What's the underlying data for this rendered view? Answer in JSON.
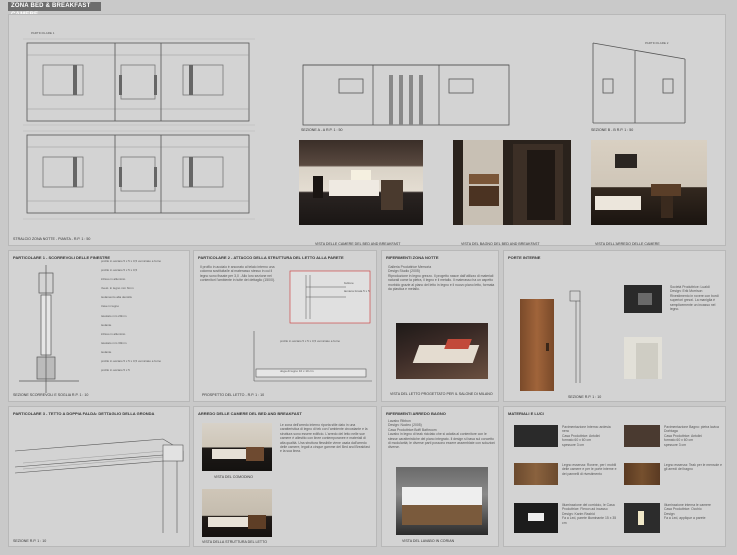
{
  "header": {
    "title": "ZONA BED & BREAKFAST CAMERE"
  },
  "top": {
    "plan_caption": "STRALCIO ZONA NOTTE - PIANTA - R.P. 1 : 50",
    "plan_note": "PARTICOLARE 1",
    "section_aa": "SEZIONE A - A  R.P. 1 : 50",
    "section_bb": "SEZIONE B - B  R.P. 1 : 50",
    "bb_note": "PARTICOLARE 2",
    "render1": "VISTA DELLE CAMERE DEL BED AND BREAKFAST",
    "render2": "VISTA DEL BAGNO DEL BED AND BREAKFAST",
    "render3": "VISTA DELL'ARREDO DELLE CAMERE"
  },
  "p1": {
    "title": "PARTICOLARE 1 - SCORREVOLI DELLE FINESTRE",
    "caption": "SEZIONE SCORREVOLI E SOGLIA  R.P. 1 : 10",
    "labels": [
      "profilo in acciaio 5 x 5 x 0,5 verniciato a forno",
      "profilo in acciaio 5 x 5 x 0,5",
      "infisso in alluminio",
      "rivest. in legno mm 6mm",
      "isolamento alta densità",
      "trave in legno",
      "tavolato mm 20mm",
      "isolante",
      "infisso in alluminio",
      "tavolato mm 30mm",
      "isolante",
      "profilo in acciaio 5 x 5 x 0,5 verniciato a forno",
      "profilo in acciaio 5 x 5"
    ]
  },
  "p2": {
    "title": "PARTICOLARE 2 - ATTACCO DELLA STRUTTURA DEL LETTO ALLA PARETE",
    "text": "Il profilo in acciaio è ancorato al telaio interno una colonna sostituita/le al materasso stesso in cui il legno sono fissate per 3,0 . Allo loro sezione nei contenitori l'ambiente in tutte dei dettaglio (150/0).",
    "caption": "PROSPETTO DEL LETTO - R.P. 1 : 10",
    "labels": [
      "profilo in acciaio 5 x 5 x 0,5 verniciato a forno",
      "bullone",
      "lamiera forata 5 x 5",
      "doga di legno 10 x 10 cm"
    ]
  },
  "p3": {
    "title": "RIFERIMENTI ZONA NOTTE",
    "text": "Galleria Produttrice Memoria\nDesign Studio (2005)\nRiproduzione in legno grezzo. Il progetto nasce dall'utilizzo di materiali naturali come la pietra, il legno e il metallo. Il materasso ha un aspetto morbido grazie al piano del letto in legno e il nuovo piano letto, formata da plastica e metallo.",
    "caption": "VISTA DEL LETTO PROGETTATO PER IL SALONE DI MILANO"
  },
  "p4": {
    "title": "PORTE INTERNE",
    "text": "Società Produttrice: Lualdi\nDesign: Erik Morrison\nRivestimento in rovere con bordi superiori grezzi. La maniglia è semplicemente un incasso nel legno.",
    "caption": "SEZIONE  R.P. 1 : 10"
  },
  "p5": {
    "title": "PARTICOLARE 3 - TETTO A DOPPIA FALDA: DETTAGLIO DELLA GRONDA",
    "caption": "SEZIONE  R.P. 1 : 10"
  },
  "p6": {
    "title": "ARREDO DELLE CAMERE DEL BED AND BREAKFAST",
    "text": "Le zona dell'arredo interno riporta stile dato in una caratteristica di legno di tek con l'ambiente circostante e la struttura sono essere edificio. L'arredo del letto nelle sue camere è allestito con linee contemporanee e materiali di alta qualità. Una struttura flessibile viene usata dall'arredo delle camere, legati a cinque gamme del Bed and Breakfast e la sua linea.",
    "cap1": "VISTA DEL COMODINO",
    "cap2": "VISTA DELLA STRUTTURA DEL LETTO"
  },
  "p7": {
    "title": "RIFERIMENTI ARREDO BAGNO",
    "text": "Lavabo Ribbon\nDesign: Nucleo (2005)\nCasa Produttrice:Boffi Bathroom\nLavabo in legno di teak riciclato che si adatta al contenitore con le stesse caratteristiche del piano integrato. Il design si basa sul concetto di modularità; le diverse parti possono essere assemblate con soluzioni diverse.",
    "caption": "VISTA DEL LAVABO IN CORIAN"
  },
  "p8": {
    "title": "MATERIALI E LUCI",
    "items": [
      {
        "text": "Pavimentazione Interna: ardesia nera\nCasa Produttrice: Antolini\nformato 60 x 60 cm\nspessore 3 cm",
        "color": "#2a2a2a"
      },
      {
        "text": "Pavimentazione Bagno: pietra lavica Dorbiaga\nCasa Produttrice: Antolini\nformato 60 x 60 cm\nspessore 3 cm",
        "color": "#4a3a30"
      },
      {
        "text": "Legno essenza: Rovere, per i mobili delle camere e per le porte interne e dei pannelli di rivestimento",
        "color": "#6b4a2e"
      },
      {
        "text": "Legno essenza: Teak per le mensole e gli arredi del bagno",
        "color": "#5a3a22"
      },
      {
        "text": "Illuminazione del corridoio, le Casa Produttrice: Flexon ad incasso\nDesign: Karim Rashid\nFa a Led, parete illuminante 15 x 35 cm",
        "color": "#1c1c1c"
      },
      {
        "text": "Illuminazione interna le camere\nCasa Produttrice: Occhio\nDesign\nFa a Led, applique a parete",
        "color": "#2c2c2c"
      }
    ]
  }
}
